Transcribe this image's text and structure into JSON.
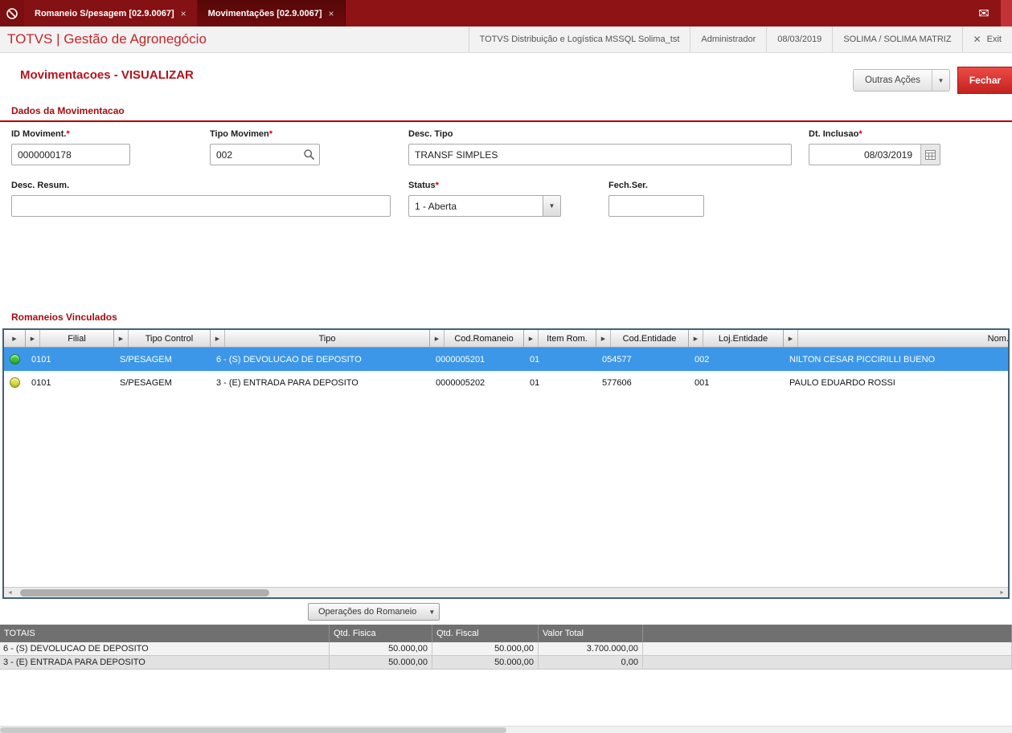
{
  "icons": {
    "mail": "✉",
    "tab_close": "×",
    "exit_x": "✕",
    "column_arrow": "▶",
    "caret_down": "▼",
    "scroll_left": "◄",
    "scroll_right": "►"
  },
  "titlebar": {
    "tabs": [
      {
        "label": "Romaneio S/pesagem [02.9.0067]"
      },
      {
        "label": "Movimentações [02.9.0067]"
      }
    ]
  },
  "appbar": {
    "brand": "TOTVS | Gestão de Agronegócio",
    "environment": "TOTVS Distribuição e Logística MSSQL Solima_tst",
    "user": "Administrador",
    "date": "08/03/2019",
    "company": "SOLIMA / SOLIMA MATRIZ",
    "exit_label": "Exit"
  },
  "page": {
    "title": "Movimentacoes - VISUALIZAR",
    "outras_acoes_label": "Outras Ações",
    "fechar_label": "Fechar"
  },
  "form": {
    "section_title": "Dados da Movimentacao",
    "required_marker": "*",
    "fields": {
      "id_moviment": {
        "label": "ID Moviment.",
        "value": "0000000178"
      },
      "tipo_movimen": {
        "label": "Tipo Movimen",
        "value": "002"
      },
      "desc_tipo": {
        "label": "Desc. Tipo",
        "value": "TRANSF SIMPLES"
      },
      "dt_inclusao": {
        "label": "Dt. Inclusao",
        "value": "08/03/2019"
      },
      "desc_resum": {
        "label": "Desc. Resum.",
        "value": ""
      },
      "status": {
        "label": "Status",
        "value": "1 - Aberta"
      },
      "fech_ser": {
        "label": "Fech.Ser.",
        "value": ""
      }
    }
  },
  "grid": {
    "section_title": "Romaneios Vinculados",
    "columns": [
      "Filial",
      "Tipo Control",
      "Tipo",
      "Cod.Romaneio",
      "Item Rom.",
      "Cod.Entidade",
      "Loj.Entidade",
      "Nom.Entidade"
    ],
    "rows": [
      {
        "status_color": "#33cc33",
        "selected": true,
        "cells": [
          "0101",
          "S/PESAGEM",
          "6 - (S) DEVOLUCAO DE DEPOSITO",
          "0000005201",
          "01",
          "054577",
          "002",
          "NILTON CESAR PICCIRILLI BUENO"
        ]
      },
      {
        "status_color": "#e3e33c",
        "selected": false,
        "cells": [
          "0101",
          "S/PESAGEM",
          "3 - (E) ENTRADA PARA DEPOSITO",
          "0000005202",
          "01",
          "577606",
          "001",
          "PAULO EDUARDO ROSSI"
        ]
      }
    ]
  },
  "operations": {
    "label": "Operações do Romaneio"
  },
  "totals": {
    "columns": [
      "TOTAIS",
      "Qtd. Fisica",
      "Qtd. Fiscal",
      "Valor Total"
    ],
    "rows": [
      {
        "label": "6 - (S) DEVOLUCAO DE DEPOSITO",
        "qtd_fisica": "50.000,00",
        "qtd_fiscal": "50.000,00",
        "valor_total": "3.700.000,00"
      },
      {
        "label": "3 - (E) ENTRADA PARA DEPOSITO",
        "qtd_fisica": "50.000,00",
        "qtd_fiscal": "50.000,00",
        "valor_total": "0,00"
      }
    ]
  },
  "colors": {
    "topbar_red": "#8e1315",
    "brand_red": "#c2262c",
    "section_red": "#a50d12",
    "selection_blue": "#3d97e8",
    "status_green": "#33cc33",
    "status_yellow": "#e3e33c",
    "totals_header_gray": "#707070"
  }
}
